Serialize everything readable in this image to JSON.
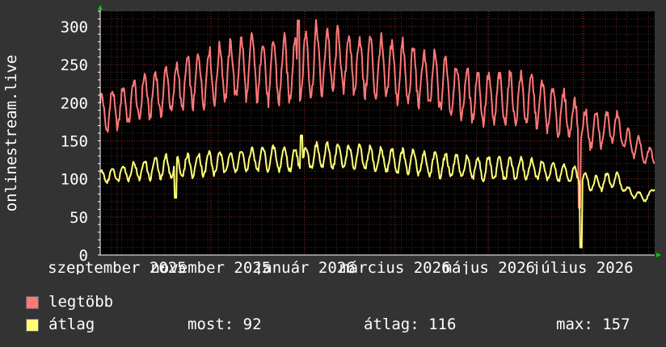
{
  "chart_data": {
    "type": "line",
    "ylabel": "onlinestream.live",
    "ylim": [
      0,
      320
    ],
    "y_ticks": [
      "0",
      "50",
      "100",
      "150",
      "200",
      "250",
      "300"
    ],
    "y_tick_values": [
      0,
      50,
      100,
      150,
      200,
      250,
      300
    ],
    "x_tick_labels": [
      "szeptember 2025",
      "november 2025",
      "január 2026",
      "március 2026",
      "május 2026",
      "július 2026"
    ],
    "x_tick_months": [
      "2025-09",
      "2025-11",
      "2026-01",
      "2026-03",
      "2026-05",
      "2026-07"
    ],
    "x_range": [
      "2025-08-21",
      "2026-08-17"
    ],
    "grid": true,
    "background": "#000000",
    "series": [
      {
        "name": "legtöbb",
        "color": "#ff7777",
        "x": [
          "2025-08-21",
          "2025-09-04",
          "2025-09-18",
          "2025-10-02",
          "2025-10-16",
          "2025-10-30",
          "2025-11-13",
          "2025-11-27",
          "2025-12-11",
          "2025-12-25",
          "2026-01-08",
          "2026-01-22",
          "2026-02-05",
          "2026-02-19",
          "2026-03-05",
          "2026-03-19",
          "2026-04-02",
          "2026-04-16",
          "2026-04-30",
          "2026-05-14",
          "2026-05-28",
          "2026-06-11",
          "2026-06-25",
          "2026-07-02",
          "2026-07-09",
          "2026-07-16",
          "2026-07-23",
          "2026-07-30",
          "2026-08-06",
          "2026-08-13",
          "2026-08-17"
        ],
        "base": [
          185,
          195,
          208,
          215,
          225,
          235,
          242,
          248,
          240,
          245,
          255,
          255,
          250,
          245,
          240,
          232,
          225,
          212,
          205,
          205,
          205,
          192,
          180,
          165,
          165,
          165,
          170,
          150,
          140,
          128,
          130
        ],
        "amp": [
          25,
          25,
          28,
          30,
          32,
          35,
          35,
          40,
          40,
          40,
          45,
          40,
          38,
          38,
          38,
          35,
          35,
          32,
          32,
          32,
          30,
          30,
          25,
          25,
          22,
          22,
          18,
          15,
          15,
          12,
          12
        ]
      },
      {
        "name": "átlag",
        "color": "#ffff77",
        "x": [
          "2025-08-21",
          "2025-09-04",
          "2025-09-18",
          "2025-10-02",
          "2025-10-16",
          "2025-10-30",
          "2025-11-13",
          "2025-11-27",
          "2025-12-11",
          "2025-12-25",
          "2026-01-08",
          "2026-01-22",
          "2026-02-05",
          "2026-02-19",
          "2026-03-05",
          "2026-03-19",
          "2026-04-02",
          "2026-04-16",
          "2026-04-30",
          "2026-05-14",
          "2026-05-28",
          "2026-06-11",
          "2026-06-25",
          "2026-07-02",
          "2026-07-09",
          "2026-07-16",
          "2026-07-23",
          "2026-07-30",
          "2026-08-06",
          "2026-08-13",
          "2026-08-17"
        ],
        "base": [
          102,
          108,
          112,
          115,
          117,
          120,
          122,
          125,
          127,
          125,
          130,
          130,
          128,
          125,
          123,
          120,
          118,
          115,
          113,
          113,
          113,
          110,
          105,
          100,
          92,
          97,
          100,
          85,
          78,
          75,
          90
        ],
        "amp": [
          8,
          10,
          12,
          15,
          15,
          15,
          15,
          15,
          15,
          15,
          15,
          15,
          15,
          15,
          15,
          15,
          15,
          15,
          15,
          15,
          12,
          12,
          10,
          10,
          10,
          10,
          10,
          5,
          5,
          5,
          5
        ]
      }
    ],
    "events": [
      {
        "date": "2025-10-09",
        "series": "átlag",
        "value": 75
      },
      {
        "date": "2025-12-28",
        "series": "legtöbb",
        "value": 308
      },
      {
        "date": "2025-12-30",
        "series": "átlag",
        "value": 157
      },
      {
        "date": "2026-06-29",
        "series": "legtöbb",
        "value": 62
      },
      {
        "date": "2026-06-30",
        "series": "átlag",
        "value": 10
      }
    ],
    "legend": [
      {
        "label": "legtöbb",
        "color": "#ff7777"
      },
      {
        "label": "átlag",
        "color": "#ffff77"
      }
    ],
    "stats": {
      "most": "most: 92",
      "atlag": "átlag: 116",
      "max": "max: 157"
    }
  }
}
